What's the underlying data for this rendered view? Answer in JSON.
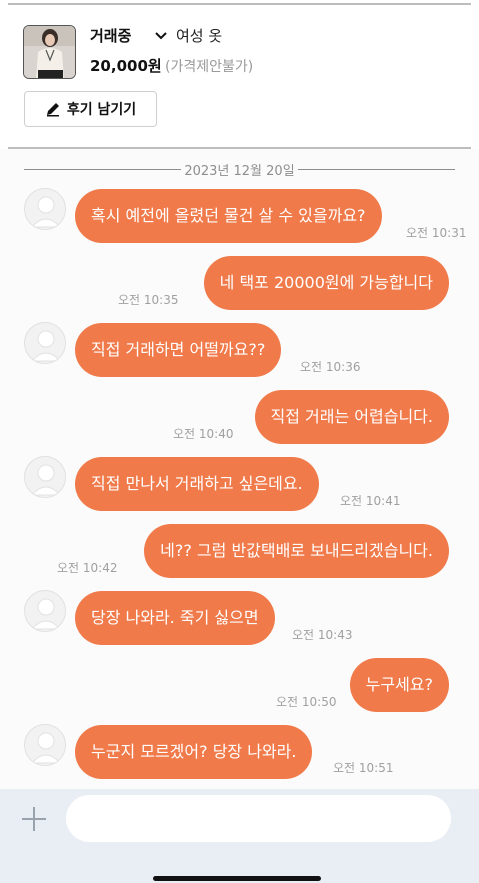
{
  "product": {
    "status": "거래중",
    "category": "여성 옷",
    "price": "20,000원",
    "price_note": "(가격제안불가)",
    "review_button": "후기 남기기"
  },
  "chat": {
    "date": "2023년 12월 20일",
    "messages": [
      {
        "side": "left",
        "text": "혹시 예전에 올렸던 물건 살 수 있을까요?",
        "time": "오전 10:31"
      },
      {
        "side": "right",
        "text": "네 택포 20000원에 가능합니다",
        "time": "오전 10:35"
      },
      {
        "side": "left",
        "text": "직접 거래하면 어떨까요??",
        "time": "오전 10:36"
      },
      {
        "side": "right",
        "text": "직접 거래는 어렵습니다.",
        "time": "오전 10:40"
      },
      {
        "side": "left",
        "text": "직접 만나서 거래하고 싶은데요.",
        "time": "오전 10:41"
      },
      {
        "side": "right",
        "text": "네?? 그럼 반값택배로 보내드리겠습니다.",
        "time": "오전 10:42"
      },
      {
        "side": "left",
        "text": "당장 나와라. 죽기 싫으면",
        "time": "오전 10:43"
      },
      {
        "side": "right",
        "text": "누구세요?",
        "time": "오전 10:50"
      },
      {
        "side": "left",
        "text": "누군지 모르겠어? 당장 나와라.",
        "time": "오전 10:51"
      }
    ]
  },
  "input": {
    "placeholder": ""
  },
  "colors": {
    "bubble": "#f07a4a",
    "input_bar": "#e9eef5",
    "timestamp": "#a0a0a0"
  },
  "icons": {
    "dropdown": "chevron-down-icon",
    "review": "pencil-icon",
    "attach": "plus-icon",
    "avatar": "default-avatar-icon"
  }
}
